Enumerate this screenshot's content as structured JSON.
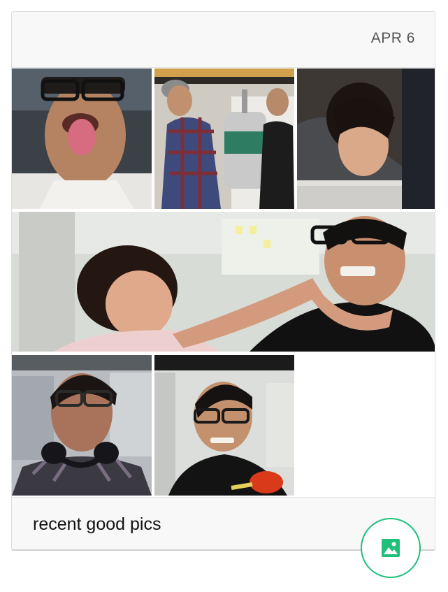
{
  "card": {
    "date": "APR 6",
    "caption": "recent good pics"
  },
  "photos": [
    {
      "name": "photo-man-tongue-out",
      "subject": "man with glasses sticking out tongue"
    },
    {
      "name": "photo-men-with-keg",
      "subject": "two men carrying a keg"
    },
    {
      "name": "photo-woman-laptop",
      "subject": "woman looking down at laptop"
    },
    {
      "name": "photo-woman-choking-man",
      "subject": "woman playfully grabbing man's neck"
    },
    {
      "name": "photo-man-headphones",
      "subject": "man with headphones around neck"
    },
    {
      "name": "photo-man-smiling",
      "subject": "smiling man with glasses"
    }
  ],
  "fab": {
    "icon": "image-icon"
  },
  "colors": {
    "accent": "#1ec07a",
    "card_bg": "#f8f8f8",
    "border": "#dcdcdc"
  }
}
